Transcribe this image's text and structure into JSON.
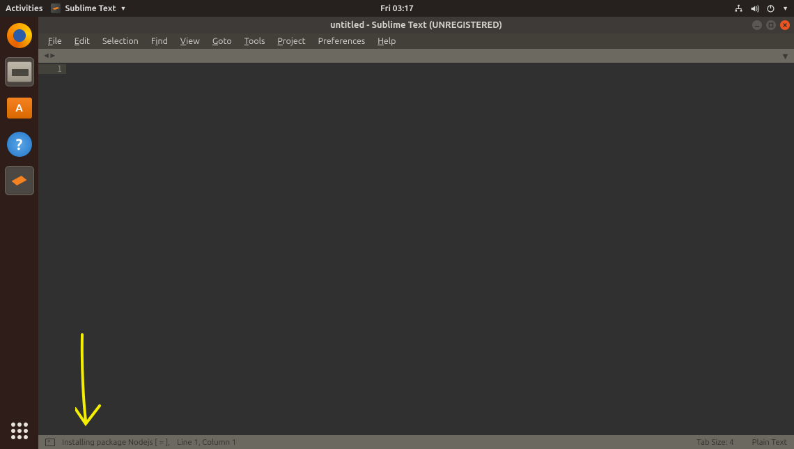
{
  "top_bar": {
    "activities": "Activities",
    "app_name": "Sublime Text",
    "clock": "Fri 03:17"
  },
  "window": {
    "title": "untitled - Sublime Text (UNREGISTERED)"
  },
  "menu": {
    "file": "File",
    "edit": "Edit",
    "selection": "Selection",
    "find": "Find",
    "view": "View",
    "goto": "Goto",
    "tools": "Tools",
    "project": "Project",
    "preferences": "Preferences",
    "help": "Help"
  },
  "editor": {
    "line_number": "1"
  },
  "status": {
    "install_msg": "Installing package Nodejs [ =       ],",
    "cursor": "Line 1, Column 1",
    "tab_size": "Tab Size: 4",
    "syntax": "Plain Text"
  },
  "dock_items": [
    "firefox",
    "files",
    "software",
    "help",
    "sublime"
  ]
}
